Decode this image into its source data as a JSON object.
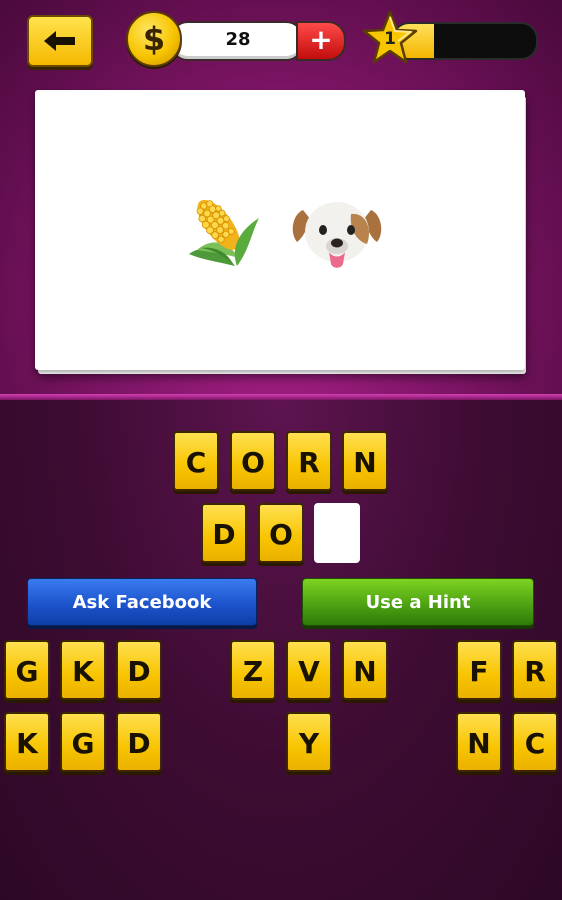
{
  "header": {
    "coins": "28",
    "add_coins_symbol": "+",
    "coin_symbol": "$",
    "level": "1",
    "level_progress": 0.28,
    "colors": {
      "accent": "#f8c400",
      "add": "#e02020"
    }
  },
  "puzzle": {
    "emojis": [
      "corn-emoji",
      "dog-face-emoji"
    ]
  },
  "answer": {
    "row1": [
      "C",
      "O",
      "R",
      "N"
    ],
    "row2": [
      "D",
      "O",
      ""
    ]
  },
  "buttons": {
    "ask_facebook": "Ask Facebook",
    "use_hint": "Use a Hint"
  },
  "letters": {
    "row1": [
      "G",
      "K",
      "D",
      "Z",
      "V",
      "N",
      "F",
      "R"
    ],
    "row2": [
      "K",
      "G",
      "D",
      "Y",
      "N",
      "C"
    ]
  }
}
